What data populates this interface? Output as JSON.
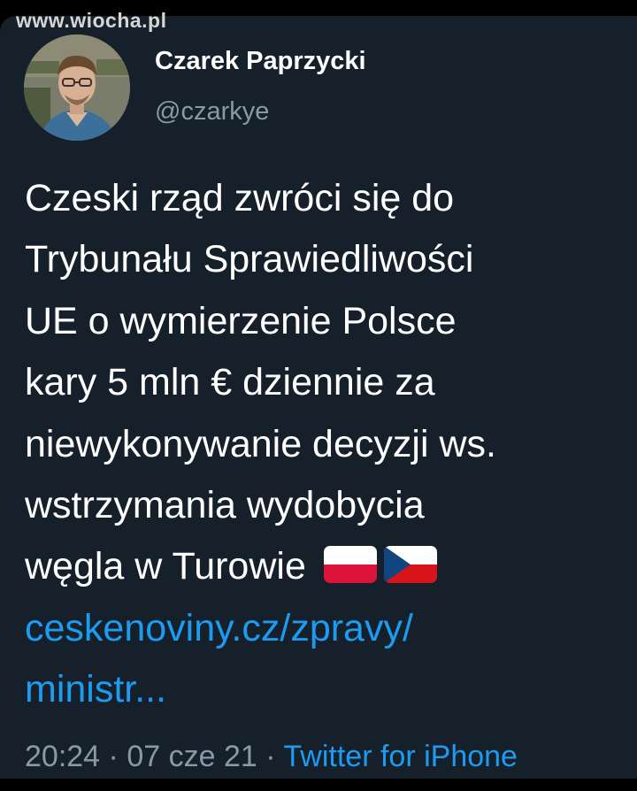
{
  "watermark": "www.wiocha.pl",
  "tweet": {
    "author_name": "Czarek Paprzycki",
    "author_handle": "@czarkye",
    "text_lines": [
      "Czeski rząd zwróci się do",
      "Trybunału Sprawiedliwości",
      "UE o wymierzenie Polsce",
      "kary 5 mln € dziennie za",
      "niewykonywanie decyzji ws.",
      "wstrzymania wydobycia",
      "węgla w Turowie"
    ],
    "flags": [
      "poland-flag-icon",
      "czech-flag-icon"
    ],
    "link_lines": [
      "ceskenoviny.cz/zpravy/",
      "ministr..."
    ],
    "time": "20:24",
    "date": "07 cze 21",
    "separator": "·",
    "source": "Twitter for iPhone"
  },
  "colors": {
    "background": "#15202b",
    "text": "#ffffff",
    "secondary_text": "#8b98a5",
    "link": "#1d9bf0"
  }
}
